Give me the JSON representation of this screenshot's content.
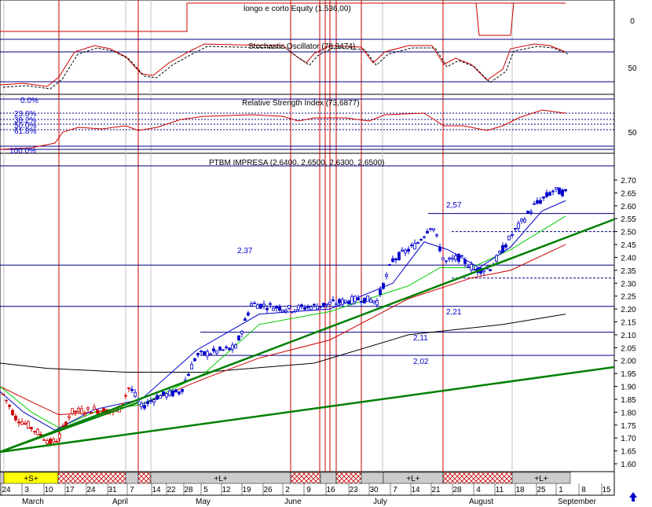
{
  "panels": {
    "equity": {
      "title": "longo e corto Equity (1.536,00)",
      "axis_label": "0"
    },
    "stochastic": {
      "title": "Stochastic Oscillator (78,9474)",
      "axis_label": "50"
    },
    "rsi": {
      "title": "Relative Strength Index (73,6877)",
      "axis_label": "50",
      "fib_labels": [
        "0.0%",
        "23.6%",
        "38.2%",
        "50.0%",
        "61.8%",
        "100.0%"
      ]
    },
    "price": {
      "title": "PTBM IMPRESA (2,6400, 2,6500, 2,6300, 2,6500)"
    }
  },
  "chart_data": {
    "type": "candlestick",
    "title": "PTBM IMPRESA (2,6400, 2,6500, 2,6300, 2,6500)",
    "ylim": [
      1.55,
      2.75
    ],
    "y_ticks": [
      "2.70",
      "2.65",
      "2.60",
      "2.55",
      "2.50",
      "2.45",
      "2.40",
      "2.35",
      "2.30",
      "2.25",
      "2.20",
      "2.15",
      "2.10",
      "2.05",
      "2.00",
      "1.95",
      "1.90",
      "1.85",
      "1.80",
      "1.75",
      "1.70",
      "1.65",
      "1.60"
    ],
    "x_ticks": [
      "24",
      "3",
      "10",
      "17",
      "24",
      "31",
      "7",
      "14",
      "22",
      "28",
      "5",
      "12",
      "19",
      "26",
      "2",
      "9",
      "16",
      "23",
      "30",
      "7",
      "14",
      "21",
      "28",
      "4",
      "11",
      "18",
      "25",
      "1",
      "8",
      "15"
    ],
    "months": [
      "March",
      "April",
      "May",
      "June",
      "July",
      "August",
      "September"
    ],
    "horizontal_levels": [
      {
        "label": "2,57",
        "value": 2.57
      },
      {
        "label": "2,37",
        "value": 2.37
      },
      {
        "label": "2,21",
        "value": 2.21
      },
      {
        "label": "2,11",
        "value": 2.11
      },
      {
        "label": "2,02",
        "value": 2.02
      }
    ],
    "dashed_levels": [
      2.5,
      2.32
    ],
    "last_close": 2.65,
    "signals": [
      {
        "label": "+S+"
      },
      {
        "label": "+L+"
      },
      {
        "label": "+L+"
      },
      {
        "label": "+L+"
      }
    ]
  },
  "colors": {
    "accent": "#0000cc",
    "grid": "#000080",
    "red": "#cc0000",
    "green": "#00cc00",
    "trend": "#008000",
    "signal_yellow": "#ffff00"
  }
}
